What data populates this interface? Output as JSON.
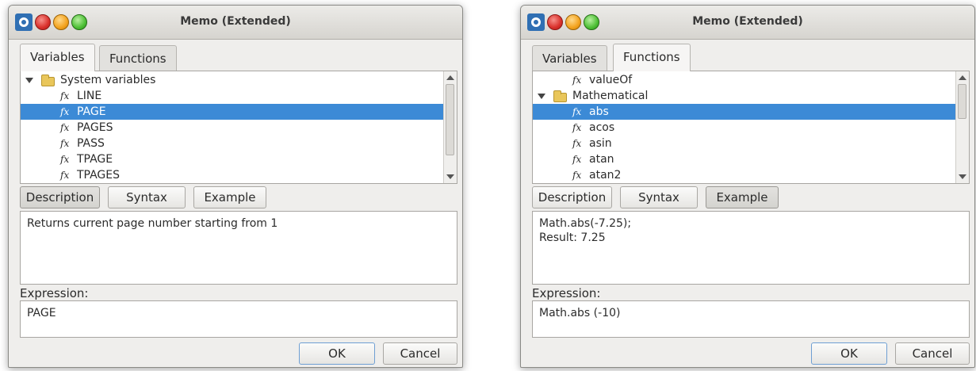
{
  "windows": [
    {
      "title": "Memo (Extended)",
      "tabs": [
        "Variables",
        "Functions"
      ],
      "active_tab": "Variables",
      "tree": [
        {
          "label": "System variables",
          "type": "folder",
          "expanded": true
        },
        {
          "label": "LINE",
          "type": "function"
        },
        {
          "label": "PAGE",
          "type": "function",
          "selected": true
        },
        {
          "label": "PAGES",
          "type": "function"
        },
        {
          "label": "PASS",
          "type": "function"
        },
        {
          "label": "TPAGE",
          "type": "function"
        },
        {
          "label": "TPAGES",
          "type": "function"
        }
      ],
      "info_buttons": [
        "Description",
        "Syntax",
        "Example"
      ],
      "active_info": "Description",
      "info_text": [
        "Returns current page number starting from 1"
      ],
      "expression_label": "Expression:",
      "expression": "PAGE",
      "ok_label": "OK",
      "cancel_label": "Cancel"
    },
    {
      "title": "Memo (Extended)",
      "tabs": [
        "Variables",
        "Functions"
      ],
      "active_tab": "Functions",
      "tree": [
        {
          "label": "valueOf",
          "type": "function"
        },
        {
          "label": "Mathematical",
          "type": "folder",
          "expanded": true
        },
        {
          "label": "abs",
          "type": "function",
          "selected": true
        },
        {
          "label": "acos",
          "type": "function"
        },
        {
          "label": "asin",
          "type": "function"
        },
        {
          "label": "atan",
          "type": "function"
        },
        {
          "label": "atan2",
          "type": "function"
        }
      ],
      "info_buttons": [
        "Description",
        "Syntax",
        "Example"
      ],
      "active_info": "Example",
      "info_text": [
        "Math.abs(-7.25);",
        "Result: 7.25"
      ],
      "expression_label": "Expression:",
      "expression": "Math.abs (-10)",
      "ok_label": "OK",
      "cancel_label": "Cancel"
    }
  ],
  "icons": {
    "app": "app-logo-icon",
    "tree_function": "fx-icon",
    "tree_folder": "folder-icon",
    "tree_expand": "triangle-down-icon"
  },
  "colors": {
    "selection": "#3c8ad6",
    "window_bg": "#efeeec",
    "close": "#d9302b",
    "minimize": "#f3a21d",
    "maximize": "#4cbf34"
  }
}
